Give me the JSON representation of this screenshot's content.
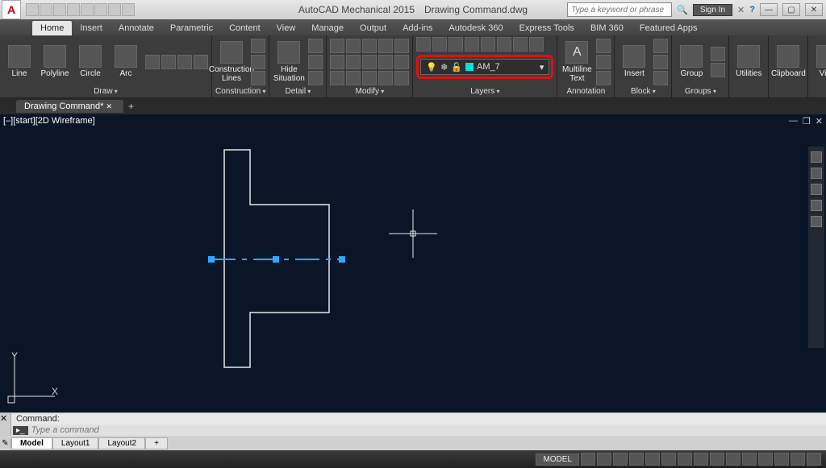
{
  "title": {
    "app": "AutoCAD Mechanical 2015",
    "doc": "Drawing Command.dwg"
  },
  "search": {
    "placeholder": "Type a keyword or phrase"
  },
  "signin": {
    "label": "Sign In"
  },
  "tabs": [
    "Home",
    "Insert",
    "Annotate",
    "Parametric",
    "Content",
    "View",
    "Manage",
    "Output",
    "Add-ins",
    "Autodesk 360",
    "Express Tools",
    "BIM 360",
    "Featured Apps"
  ],
  "active_tab": "Home",
  "panels": {
    "draw": {
      "title": "Draw",
      "items": [
        "Line",
        "Polyline",
        "Circle",
        "Arc"
      ]
    },
    "construction": {
      "title": "Construction",
      "big": "Construction Lines"
    },
    "detail": {
      "title": "Detail",
      "big": "Hide Situation"
    },
    "modify": {
      "title": "Modify"
    },
    "layers": {
      "title": "Layers",
      "current": "AM_7"
    },
    "annotation": {
      "title": "Annotation",
      "big": "Multiline Text"
    },
    "block": {
      "title": "Block",
      "big": "Insert"
    },
    "groups": {
      "title": "Groups",
      "big": "Group"
    },
    "util": {
      "title": "Utilities"
    },
    "clip": {
      "title": "Clipboard"
    },
    "view": {
      "title": "View"
    }
  },
  "file_tab": "Drawing Command*",
  "viewport": {
    "controls": "[–][start][2D Wireframe]",
    "axis_x": "X",
    "axis_y": "Y"
  },
  "command": {
    "history": "Command:",
    "placeholder": "Type a command"
  },
  "layout_tabs": [
    "Model",
    "Layout1",
    "Layout2"
  ],
  "status": {
    "mode": "MODEL"
  }
}
